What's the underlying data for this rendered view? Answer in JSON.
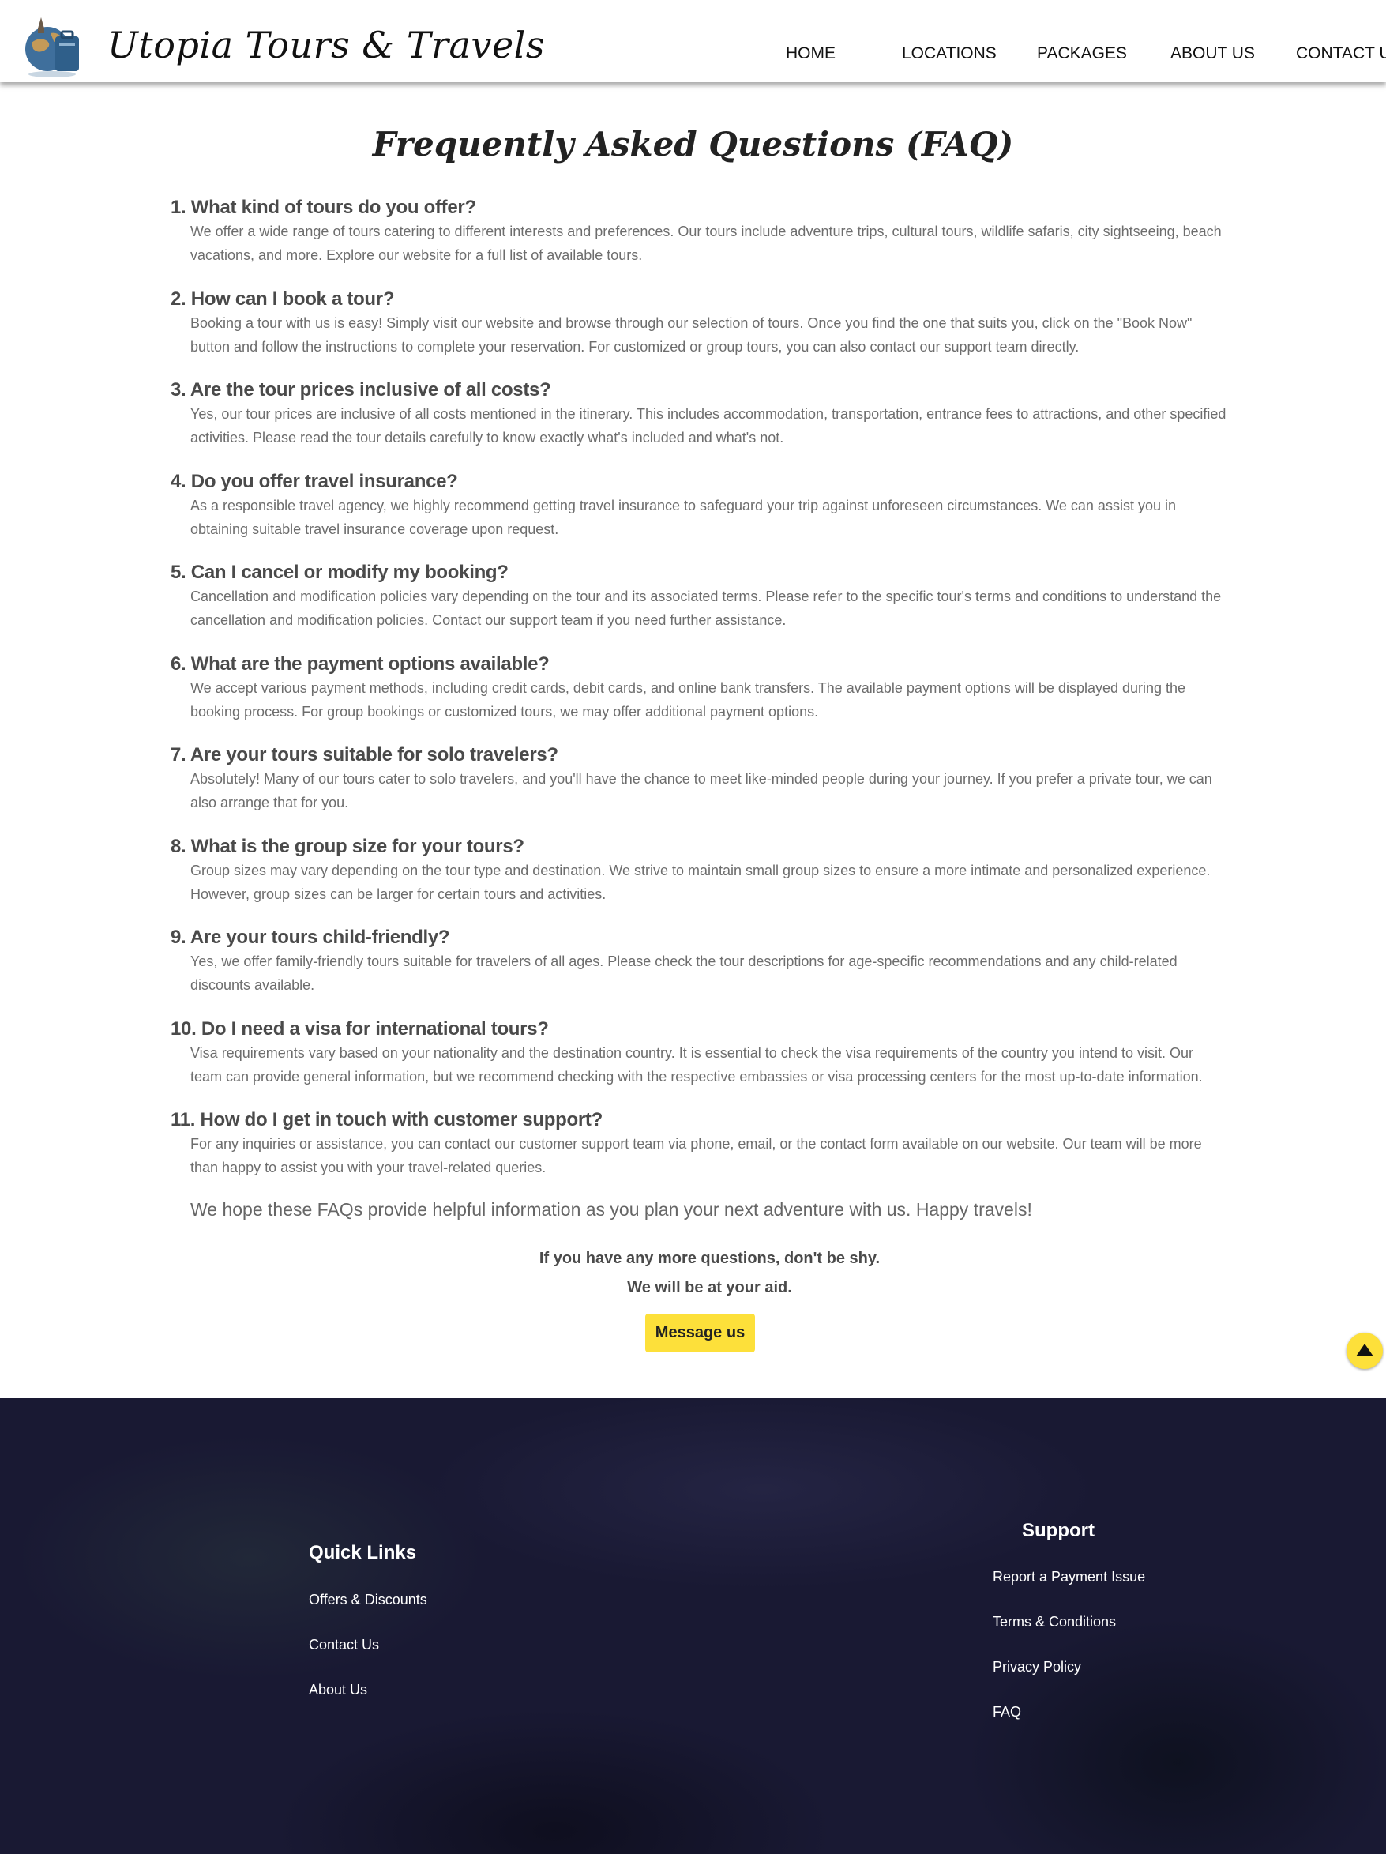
{
  "header": {
    "brand": "Utopia Tours & Travels",
    "nav": [
      {
        "label": "HOME"
      },
      {
        "label": "LOCATIONS"
      },
      {
        "label": "PACKAGES"
      },
      {
        "label": "ABOUT US"
      },
      {
        "label": "CONTACT US"
      }
    ]
  },
  "main": {
    "title": "Frequently Asked Questions (FAQ)",
    "faqs": [
      {
        "q": "1. What kind of tours do you offer?",
        "a": "We offer a wide range of tours catering to different interests and preferences. Our tours include adventure trips, cultural tours, wildlife safaris, city sightseeing, beach vacations, and more. Explore our website for a full list of available tours."
      },
      {
        "q": "2. How can I book a tour?",
        "a": "Booking a tour with us is easy! Simply visit our website and browse through our selection of tours. Once you find the one that suits you, click on the \"Book Now\" button and follow the instructions to complete your reservation. For customized or group tours, you can also contact our support team directly."
      },
      {
        "q": "3. Are the tour prices inclusive of all costs?",
        "a": "Yes, our tour prices are inclusive of all costs mentioned in the itinerary. This includes accommodation, transportation, entrance fees to attractions, and other specified activities. Please read the tour details carefully to know exactly what's included and what's not."
      },
      {
        "q": "4. Do you offer travel insurance?",
        "a": "As a responsible travel agency, we highly recommend getting travel insurance to safeguard your trip against unforeseen circumstances. We can assist you in obtaining suitable travel insurance coverage upon request."
      },
      {
        "q": "5. Can I cancel or modify my booking?",
        "a": "Cancellation and modification policies vary depending on the tour and its associated terms. Please refer to the specific tour's terms and conditions to understand the cancellation and modification policies. Contact our support team if you need further assistance."
      },
      {
        "q": "6. What are the payment options available?",
        "a": "We accept various payment methods, including credit cards, debit cards, and online bank transfers. The available payment options will be displayed during the booking process. For group bookings or customized tours, we may offer additional payment options."
      },
      {
        "q": "7. Are your tours suitable for solo travelers?",
        "a": "Absolutely! Many of our tours cater to solo travelers, and you'll have the chance to meet like-minded people during your journey. If you prefer a private tour, we can also arrange that for you."
      },
      {
        "q": "8. What is the group size for your tours?",
        "a": "Group sizes may vary depending on the tour type and destination. We strive to maintain small group sizes to ensure a more intimate and personalized experience. However, group sizes can be larger for certain tours and activities."
      },
      {
        "q": "9. Are your tours child-friendly?",
        "a": "Yes, we offer family-friendly tours suitable for travelers of all ages. Please check the tour descriptions for age-specific recommendations and any child-related discounts available."
      },
      {
        "q": "10. Do I need a visa for international tours?",
        "a": "Visa requirements vary based on your nationality and the destination country. It is essential to check the visa requirements of the country you intend to visit. Our team can provide general information, but we recommend checking with the respective embassies or visa processing centers for the most up-to-date information."
      },
      {
        "q": "11. How do I get in touch with customer support?",
        "a": "For any inquiries or assistance, you can contact our customer support team via phone, email, or the contact form available on our website. Our team will be more than happy to assist you with your travel-related queries."
      }
    ],
    "closing": "We hope these FAQs provide helpful information as you plan your next adventure with us. Happy travels!",
    "cta_line1": "If you have any more questions, don't be shy.",
    "cta_line2": "We will be at your aid.",
    "message_button": "Message us"
  },
  "footer": {
    "quick_links_title": "Quick Links",
    "quick_links": [
      "Offers & Discounts",
      "Contact Us",
      "About Us"
    ],
    "support_title": "Support",
    "support_links": [
      "Report a Payment Issue",
      "Terms & Conditions",
      "Privacy Policy",
      "FAQ"
    ]
  },
  "colors": {
    "accent": "#fde03a",
    "footer_bg": "#191933",
    "heading": "#4a4a4a",
    "body_text": "#6d6d6d"
  }
}
